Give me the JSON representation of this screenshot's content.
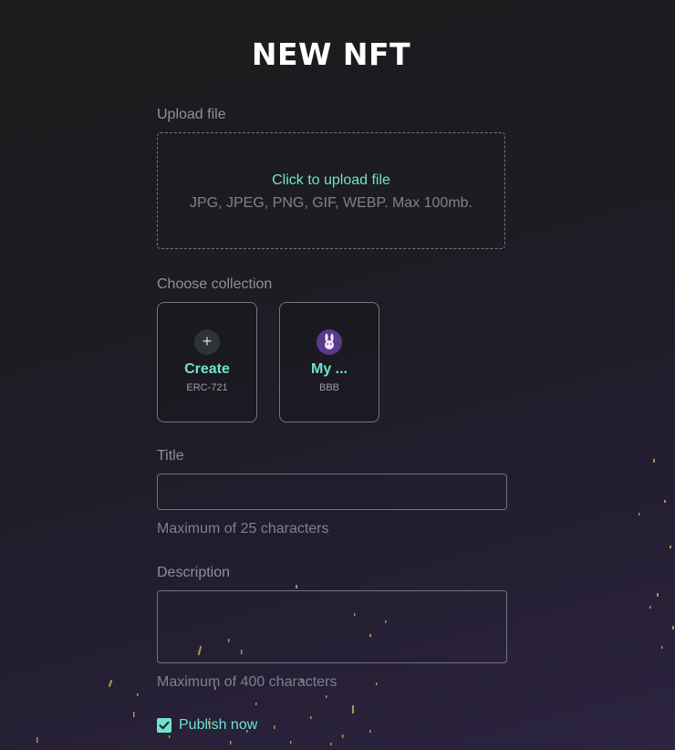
{
  "page": {
    "title": "NEW NFT"
  },
  "upload": {
    "label": "Upload file",
    "cta": "Click to upload file",
    "hint": "JPG, JPEG, PNG, GIF, WEBP. Max 100mb."
  },
  "collection": {
    "label": "Choose collection",
    "cards": [
      {
        "name": "Create",
        "sub": "ERC-721",
        "icon": "plus-icon"
      },
      {
        "name": "My ...",
        "sub": "BBB",
        "icon": "bunny-avatar-icon"
      }
    ]
  },
  "title_field": {
    "label": "Title",
    "value": "",
    "hint": "Maximum of 25 characters"
  },
  "description_field": {
    "label": "Description",
    "value": "",
    "hint": "Maximum of 400 characters"
  },
  "publish": {
    "label": "Publish now",
    "checked": true
  },
  "colors": {
    "accent": "#6fe3cf",
    "border": "#6f7580",
    "avatar": "#5a3a8c"
  }
}
